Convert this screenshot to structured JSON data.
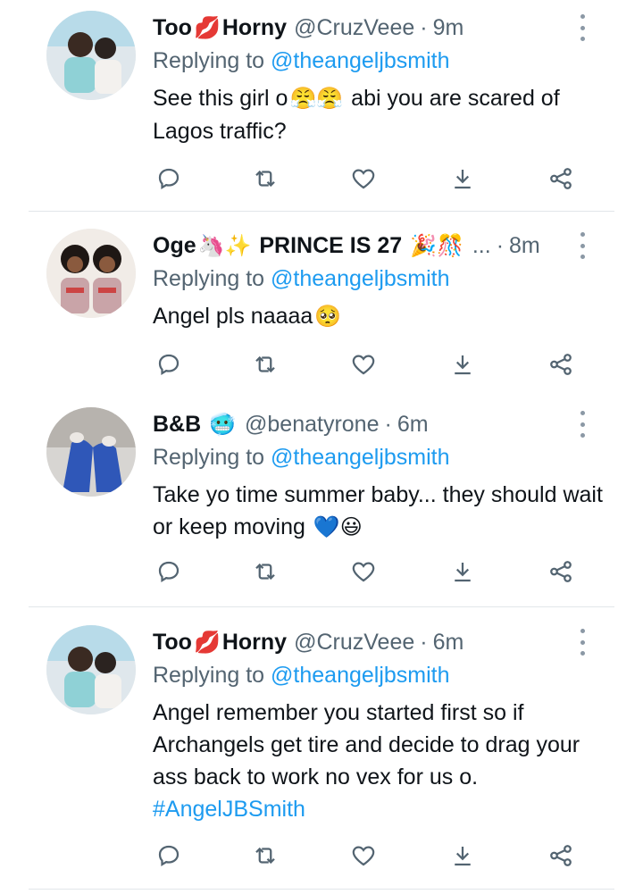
{
  "tweets": [
    {
      "name_a": "Too",
      "name_b": "Horny",
      "name_emoji": "💋",
      "handle": "@CruzVeee",
      "dot": "·",
      "time": "9m",
      "replying_prefix": "Replying to",
      "replying_to": "@theangeljbsmith",
      "body_a": "See this girl o",
      "body_emoji": "😤😤",
      "body_b": " abi you are scared of Lagos traffic?"
    },
    {
      "name_a": "Oge",
      "name_emoji": "🦄✨",
      "name_b": "PRINCE IS 27",
      "name_emoji2": "🎉🎊",
      "ellipsis": "...",
      "dot": "·",
      "time": "8m",
      "replying_prefix": "Replying to",
      "replying_to": "@theangeljbsmith",
      "body_a": "Angel pls naaaa",
      "body_emoji": "🥺"
    },
    {
      "name_a": "B&B",
      "name_emoji": "🥶",
      "handle": "@benatyrone",
      "dot": "·",
      "time": "6m",
      "replying_prefix": "Replying to",
      "replying_to": "@theangeljbsmith",
      "body_a": "Take yo time summer baby... they should wait or keep moving ",
      "body_emoji": "💙😃"
    },
    {
      "name_a": "Too",
      "name_b": "Horny",
      "name_emoji": "💋",
      "handle": "@CruzVeee",
      "dot": "·",
      "time": "6m",
      "replying_prefix": "Replying to",
      "replying_to": "@theangeljbsmith",
      "body_a": "Angel remember you started first so if Archangels get tire and decide to drag your ass back to work no vex for us o.",
      "hashtag": "#AngelJBSmith"
    }
  ],
  "icons": [
    "reply-icon",
    "retweet-icon",
    "like-icon",
    "download-icon",
    "share-icon",
    "more-icon"
  ],
  "colors": {
    "accent": "#1d9bf0",
    "secondary": "#536471",
    "icon": "#536471",
    "divider": "#e2e6ea"
  }
}
